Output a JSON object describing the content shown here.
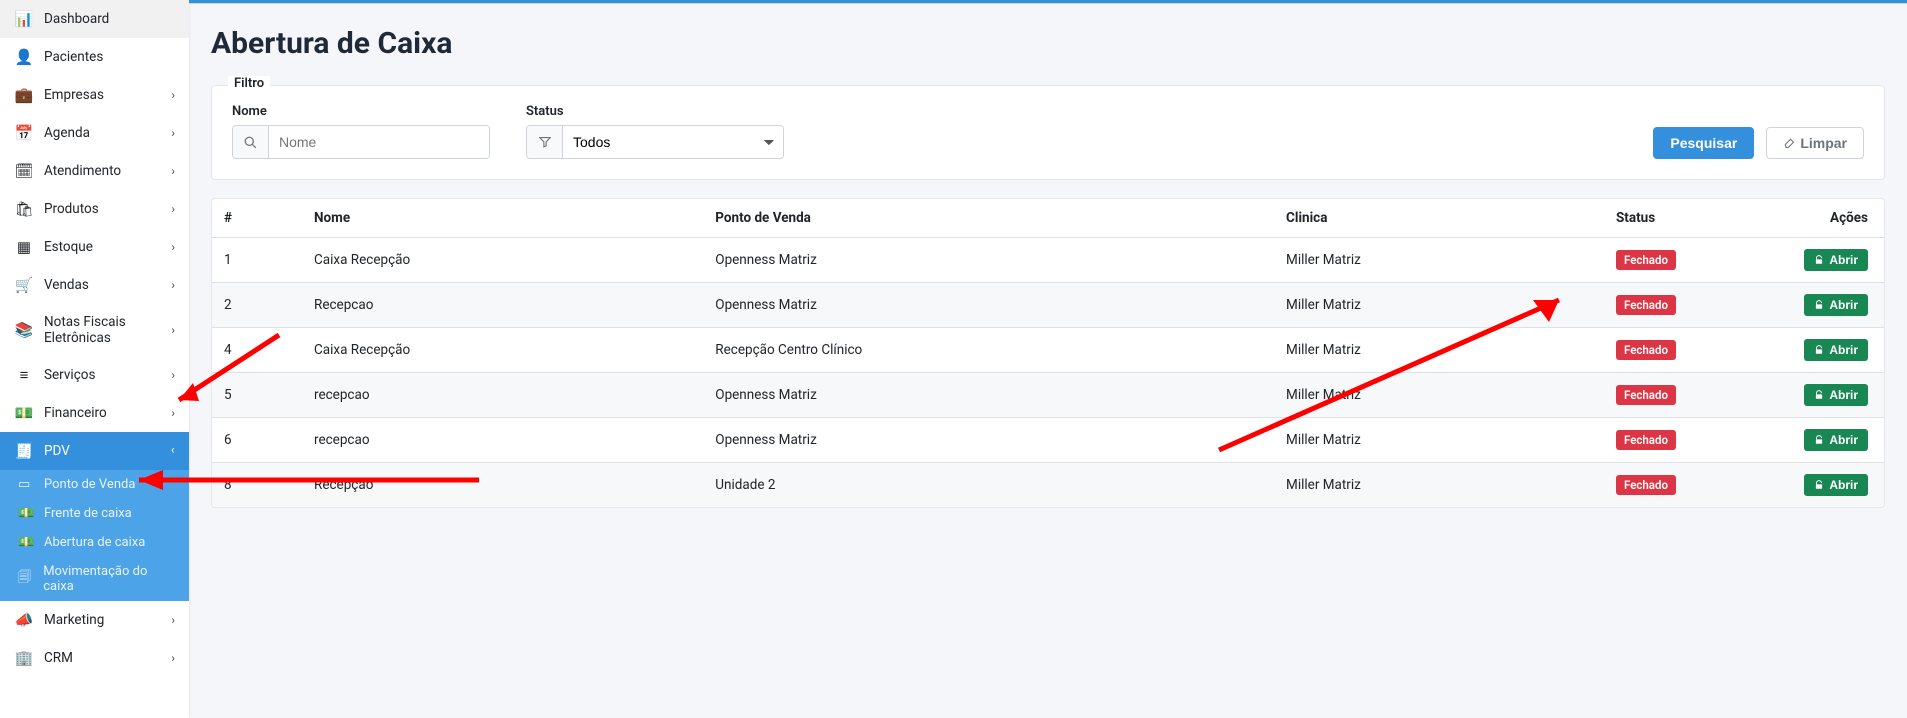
{
  "sidebar": {
    "items": [
      {
        "icon": "📊",
        "label": "Dashboard",
        "chev": false
      },
      {
        "icon": "👤",
        "label": "Pacientes",
        "chev": false
      },
      {
        "icon": "💼",
        "label": "Empresas",
        "chev": true
      },
      {
        "icon": "📅",
        "label": "Agenda",
        "chev": true
      },
      {
        "icon": "🗓",
        "label": "Atendimento",
        "chev": true
      },
      {
        "icon": "🛍",
        "label": "Produtos",
        "chev": true
      },
      {
        "icon": "▦",
        "label": "Estoque",
        "chev": true
      },
      {
        "icon": "🛒",
        "label": "Vendas",
        "chev": true
      },
      {
        "icon": "📚",
        "label": "Notas Fiscais Eletrônicas",
        "chev": true
      },
      {
        "icon": "≡",
        "label": "Serviços",
        "chev": true
      },
      {
        "icon": "💵",
        "label": "Financeiro",
        "chev": true
      }
    ],
    "pdv": {
      "icon": "🧾",
      "label": "PDV",
      "subs": [
        {
          "icon": "▭",
          "label": "Ponto de Venda"
        },
        {
          "icon": "💵",
          "label": "Frente de caixa"
        },
        {
          "icon": "💵",
          "label": "Abertura de caixa"
        },
        {
          "icon": "🗐",
          "label": "Movimentação do caixa"
        }
      ]
    },
    "after": [
      {
        "icon": "📣",
        "label": "Marketing",
        "chev": true
      },
      {
        "icon": "🏢",
        "label": "CRM",
        "chev": true
      }
    ]
  },
  "page": {
    "title": "Abertura de Caixa"
  },
  "filter": {
    "legend": "Filtro",
    "name_label": "Nome",
    "name_placeholder": "Nome",
    "status_label": "Status",
    "status_value": "Todos",
    "search_btn": "Pesquisar",
    "clear_btn": "Limpar"
  },
  "table": {
    "headers": {
      "id": "#",
      "nome": "Nome",
      "pdv": "Ponto de Venda",
      "clinica": "Clinica",
      "status": "Status",
      "acoes": "Ações"
    },
    "action_label": "Abrir",
    "status_badge": "Fechado",
    "rows": [
      {
        "id": "1",
        "nome": "Caixa Recepção",
        "pdv": "Openness Matriz",
        "clinica": "Miller Matriz"
      },
      {
        "id": "2",
        "nome": "Recepcao",
        "pdv": "Openness Matriz",
        "clinica": "Miller Matriz"
      },
      {
        "id": "4",
        "nome": "Caixa Recepção",
        "pdv": "Recepção Centro Clínico",
        "clinica": "Miller Matriz"
      },
      {
        "id": "5",
        "nome": "recepcao",
        "pdv": "Openness Matriz",
        "clinica": "Miller Matriz"
      },
      {
        "id": "6",
        "nome": "recepcao",
        "pdv": "Openness Matriz",
        "clinica": "Miller Matriz"
      },
      {
        "id": "8",
        "nome": "Recepção",
        "pdv": "Unidade 2",
        "clinica": "Miller Matriz"
      }
    ]
  }
}
